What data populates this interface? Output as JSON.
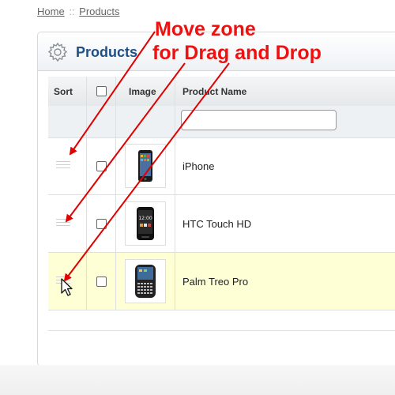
{
  "breadcrumb": {
    "home": "Home",
    "separator": "::",
    "current": "Products"
  },
  "panel": {
    "title": "Products",
    "icon": "gear-icon"
  },
  "table": {
    "columns": {
      "sort": "Sort",
      "image": "Image",
      "name": "Product Name"
    },
    "filter": {
      "name_value": ""
    },
    "rows": [
      {
        "name": "iPhone",
        "highlighted": false
      },
      {
        "name": "HTC Touch HD",
        "highlighted": false
      },
      {
        "name": "Palm Treo Pro",
        "highlighted": true
      }
    ]
  },
  "annotation": {
    "line1": "Move zone",
    "line2": "for Drag and Drop",
    "color": "#ee1111"
  },
  "colors": {
    "title": "#1e4f85",
    "highlight_row": "#ffffd6",
    "link": "#666666"
  }
}
